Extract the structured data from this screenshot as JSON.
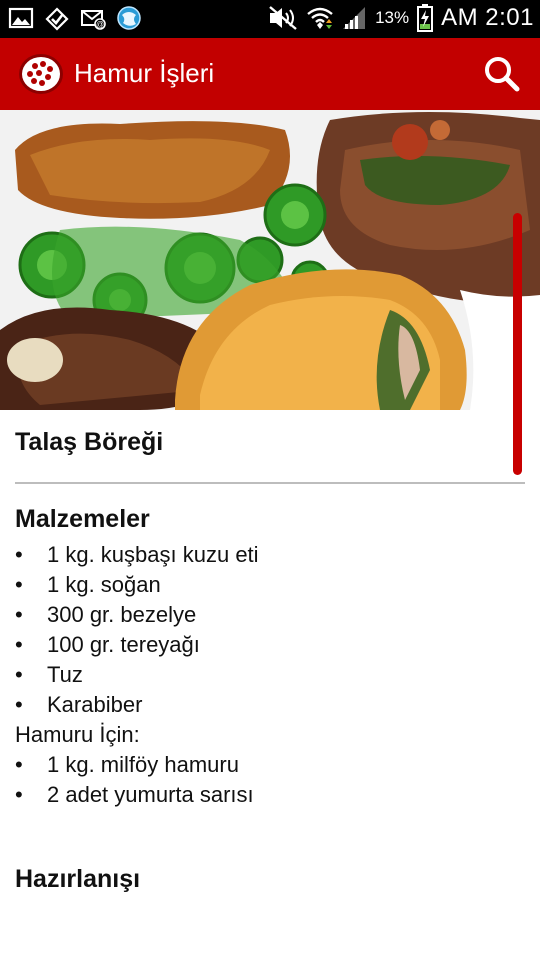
{
  "status_bar": {
    "battery_percent": "13%",
    "time": "AM 2:01",
    "icons": [
      "gallery-icon",
      "download-check-icon",
      "email-icon",
      "globe-icon",
      "mute-icon",
      "wifi-icon",
      "signal-icon",
      "battery-charging-icon"
    ]
  },
  "app_bar": {
    "title": "Hamur İşleri",
    "logo_icon": "pizza-logo-icon",
    "search_icon": "search-icon",
    "color": "#c20000"
  },
  "recipe": {
    "title": "Talaş Böreği",
    "ingredients_heading": "Malzemeler",
    "ingredients": [
      {
        "bullet": "•",
        "text": "1 kg. kuşbaşı kuzu eti"
      },
      {
        "bullet": "•",
        "text": "1 kg. soğan"
      },
      {
        "bullet": "•",
        "text": "300 gr. bezelye"
      },
      {
        "bullet": "•",
        "text": "100 gr. tereyağı"
      },
      {
        "bullet": "•",
        "text": "Tuz"
      },
      {
        "bullet": "•",
        "text": "Karabiber"
      },
      {
        "bullet": "",
        "text": "Hamuru İçin:"
      },
      {
        "bullet": "•",
        "text": "1 kg. milföy hamuru"
      },
      {
        "bullet": "•",
        "text": "2 adet yumurta sarısı"
      }
    ],
    "preparation_heading": "Hazırlanışı"
  }
}
